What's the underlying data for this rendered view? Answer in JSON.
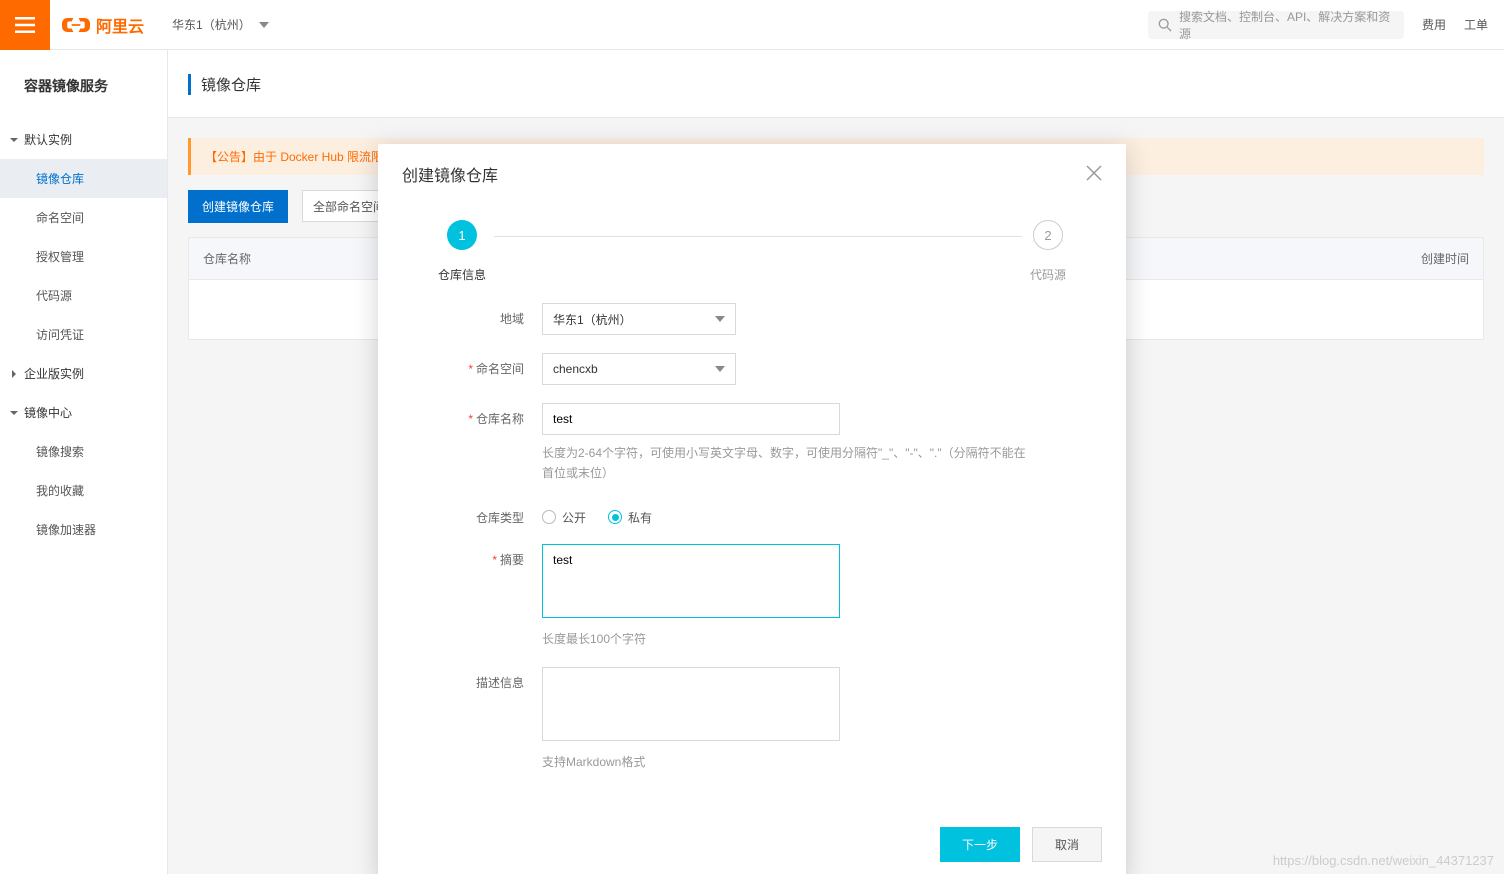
{
  "header": {
    "brand": "阿里云",
    "region": "华东1（杭州）",
    "search_placeholder": "搜索文档、控制台、API、解决方案和资源",
    "link_fee": "费用",
    "link_workorder": "工单"
  },
  "sidebar": {
    "title": "容器镜像服务",
    "groups": [
      {
        "label": "默认实例",
        "items": [
          {
            "label": "镜像仓库",
            "active": true
          },
          {
            "label": "命名空间"
          },
          {
            "label": "授权管理"
          },
          {
            "label": "代码源"
          },
          {
            "label": "访问凭证"
          }
        ]
      },
      {
        "label": "企业版实例",
        "items": []
      },
      {
        "label": "镜像中心",
        "items": [
          {
            "label": "镜像搜索"
          },
          {
            "label": "我的收藏"
          },
          {
            "label": "镜像加速器"
          }
        ]
      }
    ]
  },
  "page": {
    "title": "镜像仓库",
    "notice": "【公告】由于 Docker Hub 限流限速，影响镜像加速器获取最新 Dock",
    "create_btn": "创建镜像仓库",
    "filter_all_ns": "全部命名空间",
    "th_name": "仓库名称",
    "th_time": "创建时间"
  },
  "modal": {
    "title": "创建镜像仓库",
    "step1": "仓库信息",
    "step2": "代码源",
    "labels": {
      "region": "地域",
      "namespace": "命名空间",
      "repo_name": "仓库名称",
      "repo_type": "仓库类型",
      "summary": "摘要",
      "description": "描述信息"
    },
    "values": {
      "region": "华东1（杭州）",
      "namespace": "chencxb",
      "repo_name": "test",
      "summary": "test"
    },
    "repo_name_help": "长度为2-64个字符，可使用小写英文字母、数字，可使用分隔符\"_\"、\"-\"、\".\"（分隔符不能在首位或末位）",
    "summary_help": "长度最长100个字符",
    "desc_help": "支持Markdown格式",
    "type_public": "公开",
    "type_private": "私有",
    "btn_next": "下一步",
    "btn_cancel": "取消"
  },
  "watermark": "https://blog.csdn.net/weixin_44371237"
}
